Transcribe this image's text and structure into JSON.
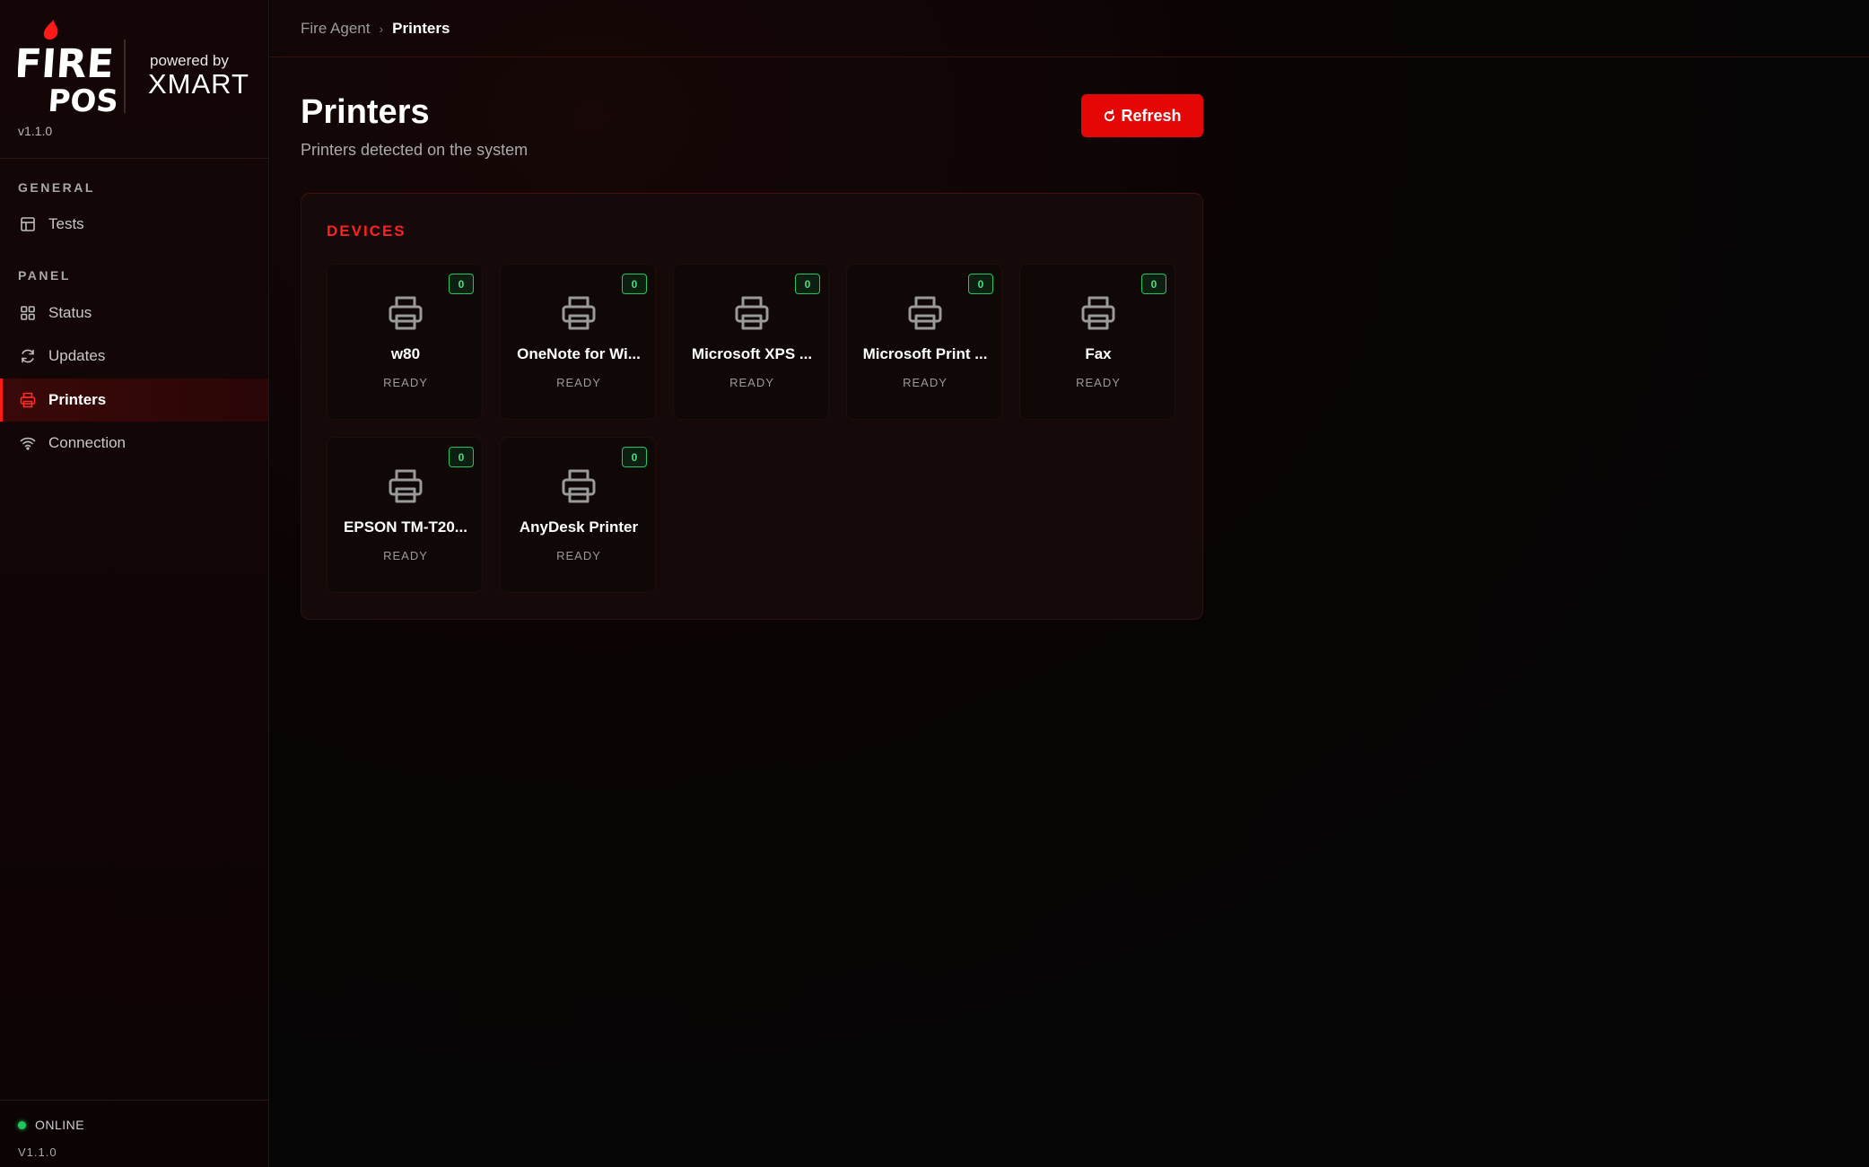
{
  "app": {
    "brand_logo": "FIRE POS",
    "powered_by": "powered by",
    "partner": "XMART",
    "version_top": "v1.1.0",
    "version_bottom": "V1.1.0"
  },
  "sidebar": {
    "sections": [
      {
        "label": "GENERAL",
        "items": [
          {
            "label": "Tests",
            "icon": "table-icon"
          }
        ]
      },
      {
        "label": "PANEL",
        "items": [
          {
            "label": "Status",
            "icon": "grid-icon"
          },
          {
            "label": "Updates",
            "icon": "refresh-icon"
          },
          {
            "label": "Printers",
            "icon": "printer-icon",
            "active": true
          },
          {
            "label": "Connection",
            "icon": "wifi-icon"
          }
        ]
      }
    ],
    "status": {
      "text": "ONLINE",
      "color": "#22c55e"
    }
  },
  "breadcrumb": {
    "parent": "Fire Agent",
    "separator": "›",
    "current": "Printers"
  },
  "page": {
    "title": "Printers",
    "subtitle": "Printers detected on the system",
    "refresh_label": "Refresh"
  },
  "devices": {
    "label": "DEVICES",
    "printers": [
      {
        "name": "w80",
        "status": "READY",
        "count": "0"
      },
      {
        "name": "OneNote for Wi...",
        "status": "READY",
        "count": "0"
      },
      {
        "name": "Microsoft XPS ...",
        "status": "READY",
        "count": "0"
      },
      {
        "name": "Microsoft Print ...",
        "status": "READY",
        "count": "0"
      },
      {
        "name": "Fax",
        "status": "READY",
        "count": "0"
      },
      {
        "name": "EPSON TM-T20...",
        "status": "READY",
        "count": "0"
      },
      {
        "name": "AnyDesk Printer",
        "status": "READY",
        "count": "0"
      }
    ]
  },
  "colors": {
    "accent": "#e50606",
    "accent_text": "#ff2020",
    "ok": "#22c55e",
    "background": "#050505"
  }
}
